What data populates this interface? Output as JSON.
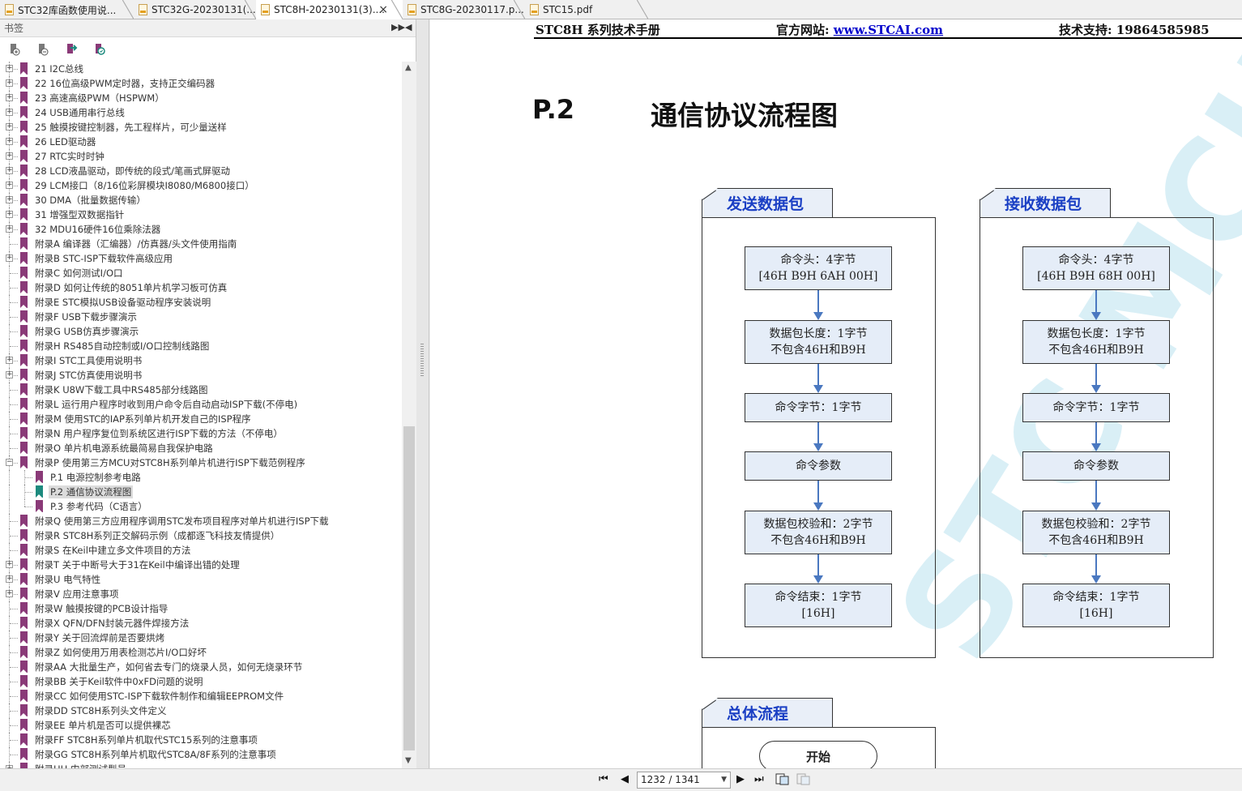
{
  "tabs": [
    {
      "label": "STC32库函数使用说...",
      "active": false
    },
    {
      "label": "STC32G-20230131(...",
      "active": false
    },
    {
      "label": "STC8H-20230131(3)....",
      "active": true
    },
    {
      "label": "STC8G-20230117.p...",
      "active": false
    },
    {
      "label": "STC15.pdf",
      "active": false
    }
  ],
  "close_glyph": "×",
  "panel": {
    "title": "书签",
    "tools": [
      "bookmark-expand-icon",
      "bookmark-collapse-icon",
      "bookmark-goto-icon",
      "bookmark-find-icon"
    ],
    "items": [
      {
        "label": "21 I2C总线",
        "level": 0,
        "expandable": true
      },
      {
        "label": "22 16位高级PWM定时器，支持正交编码器",
        "level": 0,
        "expandable": true
      },
      {
        "label": "23 高速高级PWM（HSPWM）",
        "level": 0,
        "expandable": true
      },
      {
        "label": "24 USB通用串行总线",
        "level": 0,
        "expandable": true
      },
      {
        "label": "25 触摸按键控制器，先工程样片，可少量送样",
        "level": 0,
        "expandable": true
      },
      {
        "label": "26 LED驱动器",
        "level": 0,
        "expandable": true
      },
      {
        "label": "27 RTC实时时钟",
        "level": 0,
        "expandable": true
      },
      {
        "label": "28 LCD液晶驱动，即传统的段式/笔画式屏驱动",
        "level": 0,
        "expandable": true
      },
      {
        "label": "29 LCM接口（8/16位彩屏模块I8080/M6800接口）",
        "level": 0,
        "expandable": true
      },
      {
        "label": "30 DMA（批量数据传输）",
        "level": 0,
        "expandable": true
      },
      {
        "label": "31 增强型双数据指针",
        "level": 0,
        "expandable": true
      },
      {
        "label": "32 MDU16硬件16位乘除法器",
        "level": 0,
        "expandable": true
      },
      {
        "label": "附录A 编译器（汇编器）/仿真器/头文件使用指南",
        "level": 0,
        "expandable": false
      },
      {
        "label": "附录B STC-ISP下载软件高级应用",
        "level": 0,
        "expandable": true
      },
      {
        "label": "附录C 如何测试I/O口",
        "level": 0,
        "expandable": false
      },
      {
        "label": "附录D 如何让传统的8051单片机学习板可仿真",
        "level": 0,
        "expandable": false
      },
      {
        "label": "附录E STC模拟USB设备驱动程序安装说明",
        "level": 0,
        "expandable": false
      },
      {
        "label": "附录F USB下载步骤演示",
        "level": 0,
        "expandable": false
      },
      {
        "label": "附录G USB仿真步骤演示",
        "level": 0,
        "expandable": false
      },
      {
        "label": "附录H RS485自动控制或I/O口控制线路图",
        "level": 0,
        "expandable": false
      },
      {
        "label": "附录I STC工具使用说明书",
        "level": 0,
        "expandable": true
      },
      {
        "label": "附录J STC仿真使用说明书",
        "level": 0,
        "expandable": true
      },
      {
        "label": "附录K U8W下载工具中RS485部分线路图",
        "level": 0,
        "expandable": false
      },
      {
        "label": "附录L 运行用户程序时收到用户命令后自动启动ISP下载(不停电)",
        "level": 0,
        "expandable": false
      },
      {
        "label": "附录M 使用STC的IAP系列单片机开发自己的ISP程序",
        "level": 0,
        "expandable": false
      },
      {
        "label": "附录N 用户程序复位到系统区进行ISP下载的方法（不停电）",
        "level": 0,
        "expandable": false
      },
      {
        "label": "附录O 单片机电源系统最简易自我保护电路",
        "level": 0,
        "expandable": false
      },
      {
        "label": "附录P 使用第三方MCU对STC8H系列单片机进行ISP下载范例程序",
        "level": 0,
        "expandable": true,
        "expanded": true
      },
      {
        "label": "P.1 电源控制参考电路",
        "level": 1,
        "expandable": false
      },
      {
        "label": "P.2 通信协议流程图",
        "level": 1,
        "expandable": false,
        "selected": true
      },
      {
        "label": "P.3 参考代码（C语言）",
        "level": 1,
        "expandable": false
      },
      {
        "label": "附录Q 使用第三方应用程序调用STC发布项目程序对单片机进行ISP下载",
        "level": 0,
        "expandable": false
      },
      {
        "label": "附录R STC8H系列正交解码示例（成都逐飞科技友情提供）",
        "level": 0,
        "expandable": false
      },
      {
        "label": "附录S 在Keil中建立多文件项目的方法",
        "level": 0,
        "expandable": false
      },
      {
        "label": "附录T 关于中断号大于31在Keil中编译出错的处理",
        "level": 0,
        "expandable": true
      },
      {
        "label": "附录U 电气特性",
        "level": 0,
        "expandable": true
      },
      {
        "label": "附录V 应用注意事项",
        "level": 0,
        "expandable": true
      },
      {
        "label": "附录W 触摸按键的PCB设计指导",
        "level": 0,
        "expandable": false
      },
      {
        "label": "附录X QFN/DFN封装元器件焊接方法",
        "level": 0,
        "expandable": false
      },
      {
        "label": "附录Y 关于回流焊前是否要烘烤",
        "level": 0,
        "expandable": false
      },
      {
        "label": "附录Z 如何使用万用表检测芯片I/O口好坏",
        "level": 0,
        "expandable": false
      },
      {
        "label": "附录AA 大批量生产，如何省去专门的烧录人员，如何无烧录环节",
        "level": 0,
        "expandable": false
      },
      {
        "label": "附录BB 关于Keil软件中0xFD问题的说明",
        "level": 0,
        "expandable": false
      },
      {
        "label": "附录CC 如何使用STC-ISP下载软件制作和编辑EEPROM文件",
        "level": 0,
        "expandable": false
      },
      {
        "label": "附录DD STC8H系列头文件定义",
        "level": 0,
        "expandable": false
      },
      {
        "label": "附录EE 单片机是否可以提供裸芯",
        "level": 0,
        "expandable": false
      },
      {
        "label": "附录FF STC8H系列单片机取代STC15系列的注意事项",
        "level": 0,
        "expandable": false
      },
      {
        "label": "附录GG STC8H系列单片机取代STC8A/8F系列的注意事项",
        "level": 0,
        "expandable": false
      },
      {
        "label": "附录HH 内部测试型号",
        "level": 0,
        "expandable": true
      }
    ]
  },
  "doc": {
    "header_left": "STC8H 系列技术手册",
    "header_mid_label": "官方网站: ",
    "header_mid_link": "www.STCAI.com",
    "header_right": "技术支持: 19864585985",
    "section_number": "P.2",
    "section_title": "通信协议流程图",
    "watermark": "STC MCU",
    "send": {
      "title": "发送数据包",
      "boxes": [
        [
          "命令头：4字节",
          "[46H B9H 6AH 00H]"
        ],
        [
          "数据包长度：1字节",
          "不包含46H和B9H"
        ],
        [
          "命令字节：1字节"
        ],
        [
          "命令参数"
        ],
        [
          "数据包校验和：2字节",
          "不包含46H和B9H"
        ],
        [
          "命令结束：1字节",
          "[16H]"
        ]
      ]
    },
    "receive": {
      "title": "接收数据包",
      "boxes": [
        [
          "命令头：4字节",
          "[46H B9H 68H 00H]"
        ],
        [
          "数据包长度：1字节",
          "不包含46H和B9H"
        ],
        [
          "命令字节：1字节"
        ],
        [
          "命令参数"
        ],
        [
          "数据包校验和：2字节",
          "不包含46H和B9H"
        ],
        [
          "命令结束：1字节",
          "[16H]"
        ]
      ]
    },
    "overall": {
      "title": "总体流程",
      "start": "开始"
    }
  },
  "nav": {
    "page_display": "1232 / 1341",
    "current_page": 1232,
    "total_pages": 1341
  }
}
